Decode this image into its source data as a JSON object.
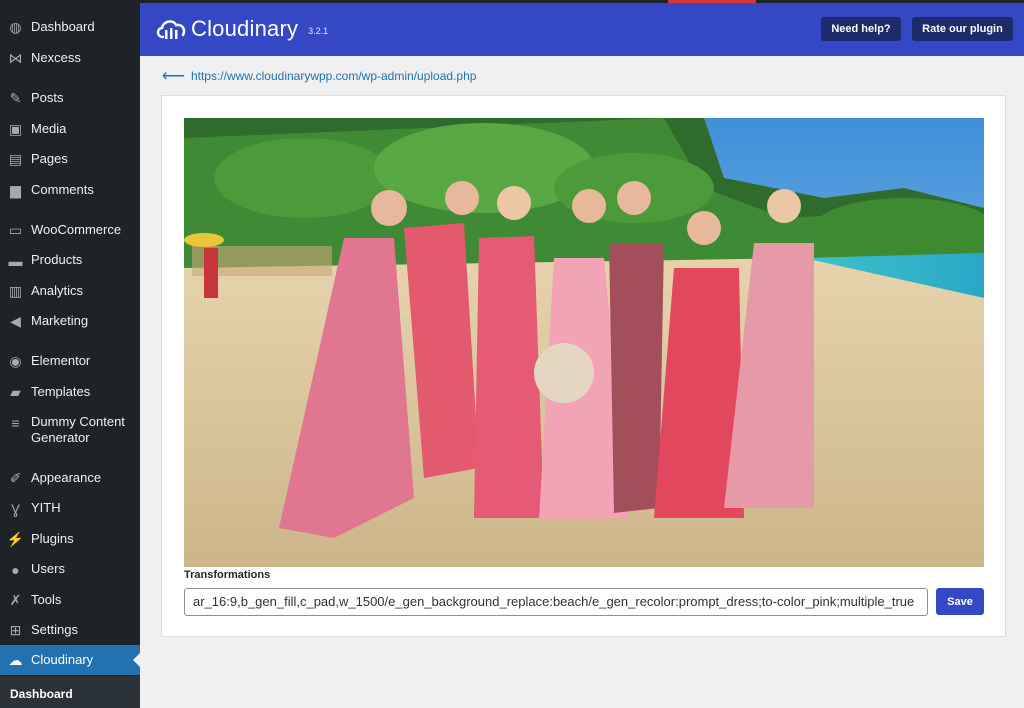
{
  "sidebar": {
    "items": [
      {
        "label": "Dashboard",
        "icon": "dashboard-icon",
        "glyph": "◍"
      },
      {
        "label": "Nexcess",
        "icon": "nexcess-icon",
        "glyph": "⋈"
      },
      {
        "label": "Posts",
        "icon": "pin-icon",
        "glyph": "✎"
      },
      {
        "label": "Media",
        "icon": "media-icon",
        "glyph": "▣"
      },
      {
        "label": "Pages",
        "icon": "pages-icon",
        "glyph": "▤"
      },
      {
        "label": "Comments",
        "icon": "comment-icon",
        "glyph": "▆"
      },
      {
        "label": "WooCommerce",
        "icon": "woocommerce-icon",
        "glyph": "▭"
      },
      {
        "label": "Products",
        "icon": "products-icon",
        "glyph": "▬"
      },
      {
        "label": "Analytics",
        "icon": "analytics-icon",
        "glyph": "▥"
      },
      {
        "label": "Marketing",
        "icon": "megaphone-icon",
        "glyph": "◀"
      },
      {
        "label": "Elementor",
        "icon": "elementor-icon",
        "glyph": "◉"
      },
      {
        "label": "Templates",
        "icon": "folder-icon",
        "glyph": "▰"
      },
      {
        "label": "Dummy Content Generator",
        "icon": "database-icon",
        "glyph": "≡"
      },
      {
        "label": "Appearance",
        "icon": "paintbrush-icon",
        "glyph": "✐"
      },
      {
        "label": "YITH",
        "icon": "yith-icon",
        "glyph": "Ɣ"
      },
      {
        "label": "Plugins",
        "icon": "plugin-icon",
        "glyph": "⚡"
      },
      {
        "label": "Users",
        "icon": "user-icon",
        "glyph": "●"
      },
      {
        "label": "Tools",
        "icon": "wrench-icon",
        "glyph": "✗"
      },
      {
        "label": "Settings",
        "icon": "settings-icon",
        "glyph": "⊞"
      },
      {
        "label": "Cloudinary",
        "icon": "cloud-icon",
        "glyph": "☁"
      }
    ],
    "submenu_label": "Dashboard"
  },
  "header": {
    "brand": "Cloudinary",
    "version": "3.2.1",
    "help_button": "Need help?",
    "rate_button": "Rate our plugin",
    "bg_color": "#3448c5"
  },
  "back_link": {
    "url": "https://www.cloudinarywpp.com/wp-admin/upload.php"
  },
  "editor": {
    "transformations_label": "Transformations",
    "transformations_value": "ar_16:9,b_gen_fill,c_pad,w_1500/e_gen_background_replace:beach/e_gen_recolor:prompt_dress;to-color_pink;multiple_true",
    "save_label": "Save"
  }
}
